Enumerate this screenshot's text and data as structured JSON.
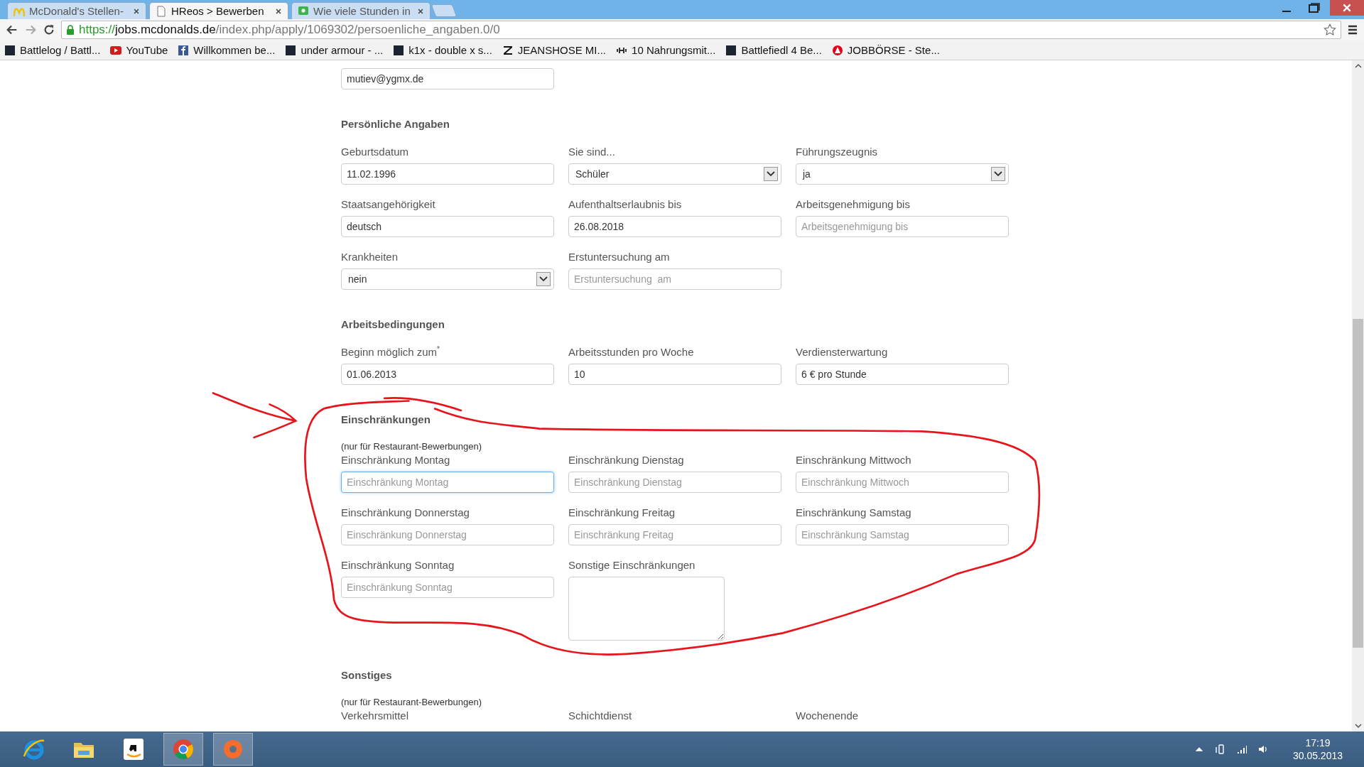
{
  "browser": {
    "tabs": [
      {
        "title": "McDonald's Stellen-",
        "kind": "arches",
        "selected": false
      },
      {
        "title": "HReos > Bewerben",
        "kind": "page",
        "selected": true
      },
      {
        "title": "Wie viele Stunden in",
        "kind": "forum",
        "selected": false
      }
    ],
    "url": {
      "scheme": "https://",
      "host": "jobs.mcdonalds.de",
      "path": "/index.php/apply/1069302/persoenliche_angaben.0/0"
    },
    "bookmarks": [
      {
        "label": "Battlelog / Battl...",
        "kind": "dark"
      },
      {
        "label": "YouTube",
        "kind": "video"
      },
      {
        "label": "Willkommen be...",
        "kind": "social"
      },
      {
        "label": "under armour - ...",
        "kind": "dark"
      },
      {
        "label": "k1x - double x s...",
        "kind": "dark"
      },
      {
        "label": "JEANSHOSE MI...",
        "kind": "letter"
      },
      {
        "label": "10 Nahrungsmit...",
        "kind": "dumbbell"
      },
      {
        "label": "Battlefiedl 4 Be...",
        "kind": "dark"
      },
      {
        "label": "JOBBÖRSE - Ste...",
        "kind": "agency"
      }
    ]
  },
  "form": {
    "email_field": {
      "value": "mutiev@ygmx.de"
    },
    "sections": [
      {
        "title": "Persönliche Angaben",
        "fields": [
          {
            "label": "Geburtsdatum",
            "kind": "input",
            "value": "11.02.1996",
            "focused": false
          },
          {
            "label": "Sie sind...",
            "kind": "select",
            "value": "Schüler",
            "focused": false
          },
          {
            "label": "Führungszeugnis",
            "kind": "select",
            "value": "ja",
            "focused": false
          },
          {
            "label": "Staatsangehörigkeit",
            "kind": "input",
            "value": "deutsch",
            "focused": false
          },
          {
            "label": "Aufenthaltserlaubnis bis",
            "kind": "input",
            "value": "26.08.2018",
            "focused": false
          },
          {
            "label": "Arbeitsgenehmigung bis",
            "kind": "input",
            "placeholder": "Arbeitsgenehmigung bis",
            "focused": false
          },
          {
            "label": "Krankheiten",
            "kind": "select",
            "value": "nein",
            "focused": false
          },
          {
            "label": "Erstuntersuchung am",
            "kind": "input",
            "placeholder": "Erstuntersuchung  am",
            "focused": false
          }
        ]
      },
      {
        "title": "Arbeitsbedingungen",
        "fields": [
          {
            "label": "Beginn möglich zum$^{*}$",
            "kind": "input",
            "value": "01.06.2013",
            "focused": false
          },
          {
            "label": "Arbeitsstunden pro Woche",
            "kind": "input",
            "value": "10",
            "focused": false
          },
          {
            "label": "Verdiensterwartung",
            "kind": "input",
            "value": "6 € pro Stunde",
            "focused": false
          }
        ]
      },
      {
        "title": "Einschränkungen",
        "note": "(nur für Restaurant-Bewerbungen)",
        "fields": [
          {
            "label": "Einschränkung Montag",
            "kind": "input",
            "placeholder": "Einschränkung Montag",
            "focused": true
          },
          {
            "label": "Einschränkung Dienstag",
            "kind": "input",
            "placeholder": "Einschränkung Dienstag",
            "focused": false
          },
          {
            "label": "Einschränkung Mittwoch",
            "kind": "input",
            "placeholder": "Einschränkung Mittwoch",
            "focused": false
          },
          {
            "label": "Einschränkung Donnerstag",
            "kind": "input",
            "placeholder": "Einschränkung Donnerstag",
            "focused": false
          },
          {
            "label": "Einschränkung Freitag",
            "kind": "input",
            "placeholder": "Einschränkung Freitag",
            "focused": false
          },
          {
            "label": "Einschränkung Samstag",
            "kind": "input",
            "placeholder": "Einschränkung Samstag",
            "focused": false
          },
          {
            "label": "Einschränkung Sonntag",
            "kind": "input",
            "placeholder": "Einschränkung Sonntag",
            "focused": false
          },
          {
            "label": "Sonstige Einschränkungen",
            "kind": "textarea",
            "focused": false
          }
        ]
      },
      {
        "title": "Sonstiges",
        "note": "(nur für Restaurant-Bewerbungen)",
        "fields": [
          {
            "label": "Verkehrsmittel",
            "kind": "label"
          },
          {
            "label": "Schichtdienst",
            "kind": "label"
          },
          {
            "label": "Wochenende",
            "kind": "label"
          }
        ]
      }
    ]
  },
  "taskbar": {
    "apps": [
      {
        "kind": "ie",
        "selected": false
      },
      {
        "kind": "folder",
        "selected": false
      },
      {
        "kind": "shop",
        "selected": false
      },
      {
        "kind": "chrome",
        "selected": true
      },
      {
        "kind": "origin",
        "selected": true
      }
    ],
    "time": "17:19",
    "date": "30.05.2013"
  }
}
